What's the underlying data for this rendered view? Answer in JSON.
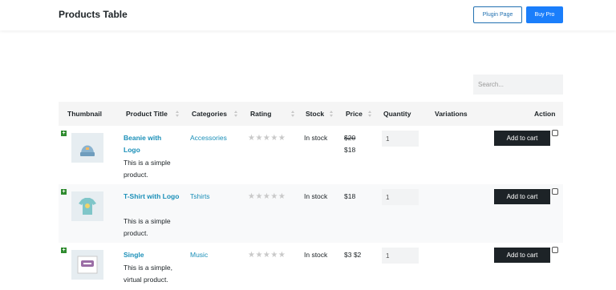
{
  "header": {
    "title": "Products Table",
    "plugin_page": "Plugin Page",
    "buy_pro": "Buy Pro"
  },
  "search": {
    "placeholder": "Search..."
  },
  "columns": [
    "Thumbnail",
    "Product Title",
    "Categories",
    "Rating",
    "Stock",
    "Price",
    "Quantity",
    "Variations",
    "Action"
  ],
  "rows": [
    {
      "title": "Beanie with Logo",
      "description": "This is a simple product.",
      "category": "Accessories",
      "stock": "In stock",
      "price_old": "$20",
      "price": "$18",
      "quantity": "1",
      "action": "Add to cart",
      "thumb_icon": "beanie-icon"
    },
    {
      "title": "T-Shirt with Logo",
      "description": "This is a simple product.",
      "category": "Tshirts",
      "stock": "In stock",
      "price_old": "",
      "price": "$18",
      "quantity": "1",
      "action": "Add to cart",
      "thumb_icon": "tshirt-icon"
    },
    {
      "title": "Single",
      "description": "This is a simple, virtual product.",
      "category": "Music",
      "stock": "In stock",
      "price_old": "",
      "price": "$3 $2",
      "quantity": "1",
      "action": "Add to cart",
      "thumb_icon": "woo-album-icon"
    }
  ],
  "rating_stars": "★★★★★",
  "expand_symbol": "+",
  "colors": {
    "accent": "#1a7efb",
    "link": "#1a8fb8",
    "cart_button": "#1d2327",
    "expand": "#2e8b2e"
  }
}
